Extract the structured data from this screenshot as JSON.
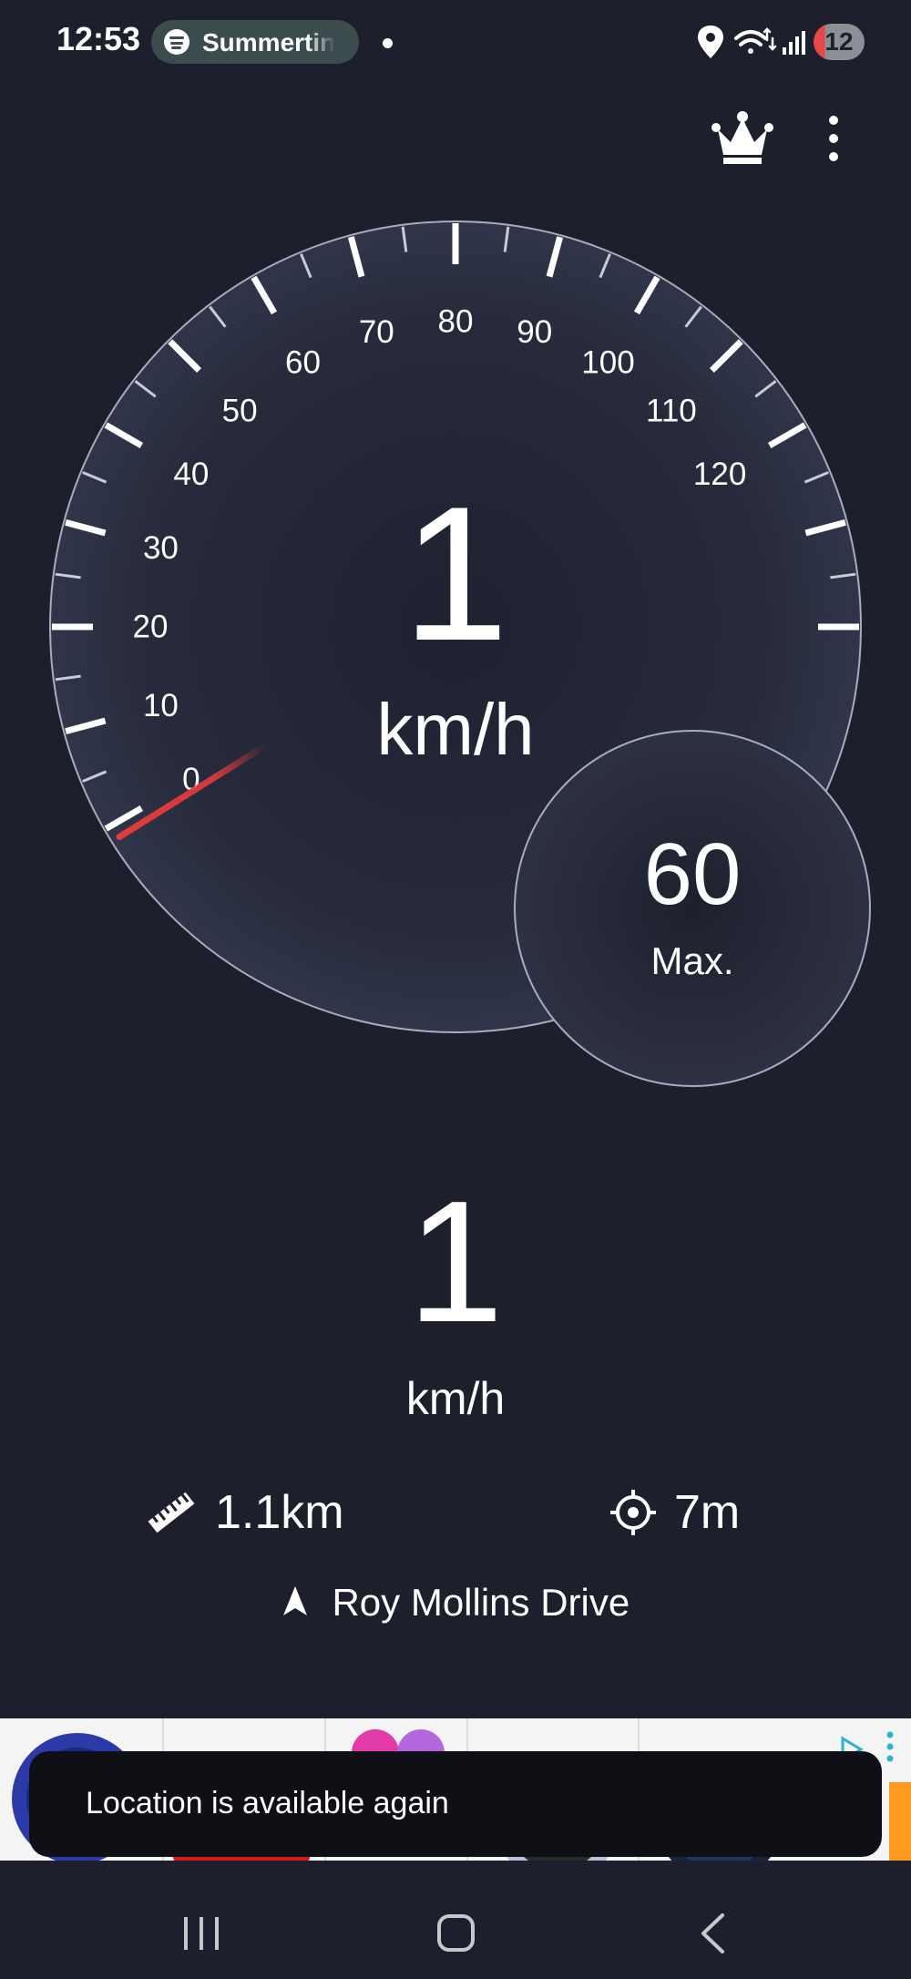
{
  "status_bar": {
    "time": "12:53",
    "media_title": "Summertin",
    "battery": "12",
    "icons": [
      "spotify-icon",
      "location-pin-icon",
      "wifi-icon",
      "signal-icon",
      "battery-icon"
    ]
  },
  "toolbar": {
    "icons": [
      "crown-icon",
      "more-vert-icon"
    ]
  },
  "speedometer": {
    "scale_labels": [
      "0",
      "10",
      "20",
      "30",
      "40",
      "50",
      "60",
      "70",
      "80",
      "90",
      "100",
      "110",
      "120"
    ],
    "speed": "1",
    "unit": "km/h",
    "needle_value": 0,
    "max_value": "60",
    "max_label": "Max.",
    "colors": {
      "background": "#1d202c",
      "needle": "#e23b3b",
      "ring": "#a9abc0"
    }
  },
  "digital": {
    "speed": "1",
    "unit": "km/h"
  },
  "stats": {
    "distance": "1.1km",
    "accuracy": "7m",
    "street": "Roy Mollins Drive",
    "icons": [
      "ruler-icon",
      "crosshair-icon",
      "navigation-arrow-icon"
    ]
  },
  "toast": {
    "message": "Location is available again"
  },
  "ad": {
    "icons": [
      "ad-choices-icon",
      "more-vert-icon"
    ]
  },
  "nav_bar": {
    "icons": [
      "recents-icon",
      "home-icon",
      "back-icon"
    ]
  }
}
